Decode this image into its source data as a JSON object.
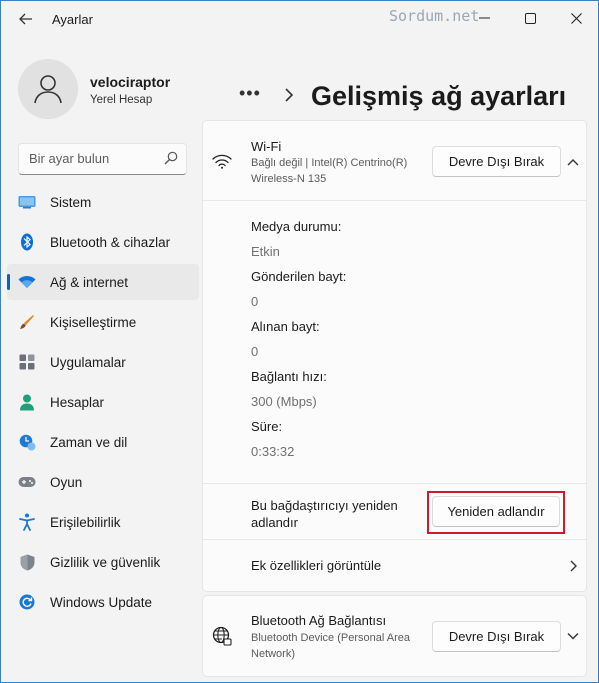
{
  "window": {
    "title": "Ayarlar",
    "watermark": "Sordum.net",
    "minimize_glyph": "—",
    "maximize_glyph": "☐",
    "close_glyph": "✕"
  },
  "profile": {
    "name": "velociraptor",
    "account_type": "Yerel Hesap"
  },
  "search": {
    "placeholder": "Bir ayar bulun"
  },
  "sidebar": {
    "items": [
      {
        "label": "Sistem",
        "icon": "monitor-icon",
        "color": "#3a86d1"
      },
      {
        "label": "Bluetooth & cihazlar",
        "icon": "bluetooth-icon",
        "color": "#0a6fd6"
      },
      {
        "label": "Ağ & internet",
        "icon": "wifi-icon",
        "color": "#1473d8",
        "active": true
      },
      {
        "label": "Kişiselleştirme",
        "icon": "brush-icon",
        "color": "#e08a2a"
      },
      {
        "label": "Uygulamalar",
        "icon": "apps-icon",
        "color": "#6b6f7a"
      },
      {
        "label": "Hesaplar",
        "icon": "person-icon",
        "color": "#1ea17a"
      },
      {
        "label": "Zaman ve dil",
        "icon": "clock-globe-icon",
        "color": "#1f7ad4"
      },
      {
        "label": "Oyun",
        "icon": "gamepad-icon",
        "color": "#7a7f88"
      },
      {
        "label": "Erişilebilirlik",
        "icon": "accessibility-icon",
        "color": "#1a78d0"
      },
      {
        "label": "Gizlilik ve güvenlik",
        "icon": "shield-icon",
        "color": "#7d838c"
      },
      {
        "label": "Windows Update",
        "icon": "update-icon",
        "color": "#1a78d0"
      }
    ]
  },
  "header": {
    "breadcrumb_more": "•••",
    "title": "Gelişmiş ağ ayarları"
  },
  "wifi_adapter": {
    "name": "Wi-Fi",
    "description": "Bağlı değil | Intel(R) Centrino(R) Wireless-N 135",
    "disable_label": "Devre Dışı Bırak",
    "expanded": true,
    "properties": [
      {
        "label": "Medya durumu:",
        "value": "Etkin"
      },
      {
        "label": "Gönderilen bayt:",
        "value": "0"
      },
      {
        "label": "Alınan bayt:",
        "value": "0"
      },
      {
        "label": "Bağlantı hızı:",
        "value": "300 (Mbps)"
      },
      {
        "label": "Süre:",
        "value": "0:33:32"
      }
    ],
    "rename_text": "Bu bağdaştırıcıyı yeniden adlandır",
    "rename_button": "Yeniden adlandır",
    "more_properties": "Ek özellikleri görüntüle"
  },
  "bluetooth_adapter": {
    "name": "Bluetooth Ağ Bağlantısı",
    "description": "Bluetooth Device (Personal Area Network)",
    "disable_label": "Devre Dışı Bırak"
  },
  "colors": {
    "accent": "#0067c0",
    "highlight_box": "#d1192d"
  }
}
